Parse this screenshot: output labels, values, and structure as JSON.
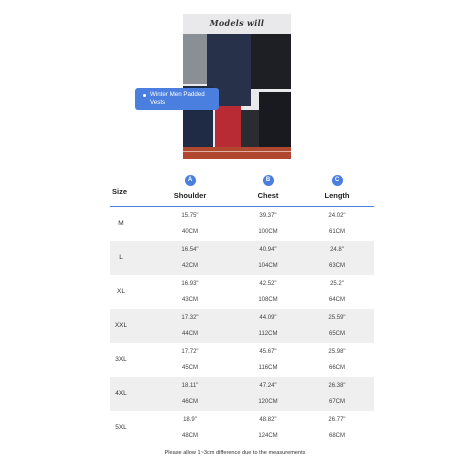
{
  "product": {
    "collage_title": "Models will",
    "collage_subtitle": "···",
    "tooltip_label": "Winter Men Padded Vests"
  },
  "table": {
    "size_header": "Size",
    "columns": [
      {
        "badge": "A",
        "label": "Shoulder"
      },
      {
        "badge": "B",
        "label": "Chest"
      },
      {
        "badge": "C",
        "label": "Length"
      }
    ],
    "rows": [
      {
        "size": "M",
        "inch": [
          "15.75\"",
          "39.37\"",
          "24.02\""
        ],
        "cm": [
          "40CM",
          "100CM",
          "61CM"
        ]
      },
      {
        "size": "L",
        "inch": [
          "16.54\"",
          "40.94\"",
          "24.8\""
        ],
        "cm": [
          "42CM",
          "104CM",
          "63CM"
        ]
      },
      {
        "size": "XL",
        "inch": [
          "16.93\"",
          "42.52\"",
          "25.2\""
        ],
        "cm": [
          "43CM",
          "108CM",
          "64CM"
        ]
      },
      {
        "size": "XXL",
        "inch": [
          "17.32\"",
          "44.09\"",
          "25.59\""
        ],
        "cm": [
          "44CM",
          "112CM",
          "65CM"
        ]
      },
      {
        "size": "3XL",
        "inch": [
          "17.72\"",
          "45.67\"",
          "25.98\""
        ],
        "cm": [
          "45CM",
          "116CM",
          "66CM"
        ]
      },
      {
        "size": "4XL",
        "inch": [
          "18.11\"",
          "47.24\"",
          "26.38\""
        ],
        "cm": [
          "46CM",
          "120CM",
          "67CM"
        ]
      },
      {
        "size": "5XL",
        "inch": [
          "18.9\"",
          "48.82\"",
          "26.77\""
        ],
        "cm": [
          "48CM",
          "124CM",
          "68CM"
        ]
      }
    ],
    "note": "Please allow 1~3cm difference due to the measurements"
  }
}
